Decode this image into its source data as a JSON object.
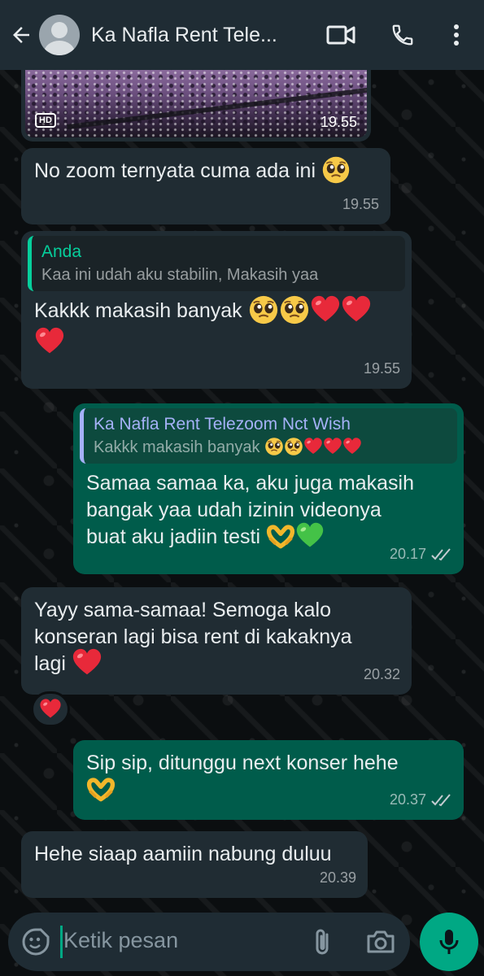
{
  "header": {
    "title": "Ka Nafla Rent Tele...",
    "back_icon": "arrow-left-icon",
    "video_icon": "video-call-icon",
    "call_icon": "phone-icon",
    "menu_icon": "more-vertical-icon"
  },
  "colors": {
    "header_bg": "#1f2c34",
    "incoming_bubble": "#202c33",
    "outgoing_bubble": "#005c4b",
    "accent": "#00a884",
    "quote_you": "#06cf9c",
    "quote_contact": "#a5b1f7"
  },
  "messages": [
    {
      "type": "video",
      "direction": "in",
      "badge": "HD",
      "time": "19.55"
    },
    {
      "direction": "in",
      "text": "No zoom ternyata cuma ada ini",
      "emoji": [
        "pleading-face"
      ],
      "time": "19.55"
    },
    {
      "direction": "in",
      "quote": {
        "name": "Anda",
        "text": "Kaa ini udah aku stabilin, Makasih yaa"
      },
      "text": "Kakkk makasih banyak",
      "emoji": [
        "pleading-face",
        "pleading-face",
        "red-heart",
        "red-heart",
        "red-heart"
      ],
      "time": "19.55"
    },
    {
      "direction": "out",
      "quote": {
        "name": "Ka Nafla Rent Telezoom Nct Wish",
        "text": "Kakkk makasih banyak"
      },
      "text_lines": [
        "Samaa samaa ka, aku juga makasih",
        "bangak yaa udah izinin videonya",
        "buat aku jadiin testi"
      ],
      "emoji": [
        "heart-hands",
        "green-heart"
      ],
      "time": "20.17",
      "status": "read"
    },
    {
      "direction": "in",
      "text_lines": [
        "Yayy sama-samaa! Semoga kalo",
        "konseran lagi bisa rent di kakaknya",
        "lagi"
      ],
      "emoji": [
        "red-heart"
      ],
      "time": "20.32",
      "reaction": "red-heart"
    },
    {
      "direction": "out",
      "text": "Sip sip, ditunggu next konser hehe",
      "emoji": [
        "heart-hands"
      ],
      "time": "20.37",
      "status": "read"
    },
    {
      "direction": "in",
      "text": "Hehe siaap aamiin nabung duluu",
      "time": "20.39"
    }
  ],
  "input": {
    "placeholder": "Ketik pesan",
    "emoji_icon": "emoji-icon",
    "attach_icon": "paperclip-icon",
    "camera_icon": "camera-icon",
    "mic_icon": "microphone-icon"
  }
}
